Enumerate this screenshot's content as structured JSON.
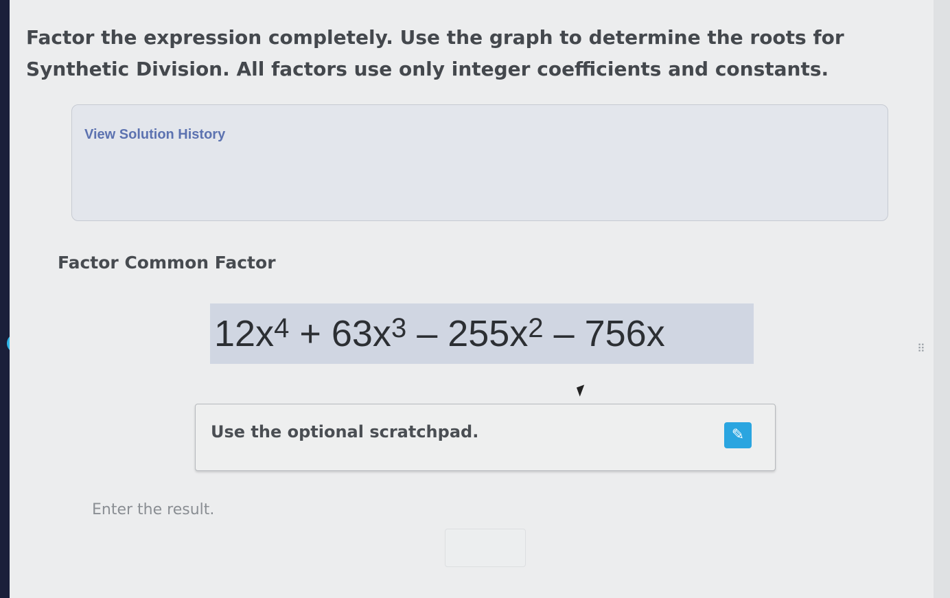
{
  "instructions": "Factor the expression completely. Use the graph to determine the roots for Synthetic Division. All factors use only integer coefficients and constants.",
  "solution_history": {
    "link_label": "View Solution History"
  },
  "step": {
    "title": "Factor Common Factor"
  },
  "expression": {
    "t1_coef": "12x",
    "t1_exp": "4",
    "t2_coef": " + 63x",
    "t2_exp": "3",
    "t3_coef": " – 255x",
    "t3_exp": "2",
    "t4": " – 756x"
  },
  "scratchpad": {
    "label": "Use the optional scratchpad.",
    "icon": "pencil-icon"
  },
  "result": {
    "label": "Enter the result.",
    "value": ""
  },
  "colors": {
    "accent": "#2fb6e8",
    "sidebar": "#3a4fd4",
    "highlight": "#d0d6e2"
  }
}
